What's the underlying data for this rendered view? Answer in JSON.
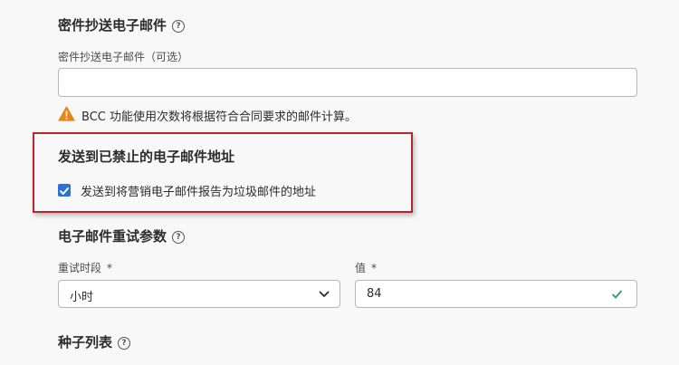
{
  "bcc_section": {
    "title": "密件抄送电子邮件",
    "field_label": "密件抄送电子邮件（可选）",
    "field_value": "",
    "warning_text": "BCC 功能使用次数将根据符合合同要求的邮件计算。"
  },
  "banned_section": {
    "title": "发送到已禁止的电子邮件地址",
    "checkbox_label": "发送到将营销电子邮件报告为垃圾邮件的地址",
    "checkbox_checked": true
  },
  "retry_section": {
    "title": "电子邮件重试参数",
    "period_label": "重试时段",
    "period_value": "小时",
    "value_label": "值",
    "value_value": "84",
    "required_mark": "*"
  },
  "seed_section": {
    "title": "种子列表"
  },
  "colors": {
    "highlight_border": "#b3282d",
    "checkbox": "#2f6fd8",
    "valid_check": "#2d9d78",
    "warning": "#e68619"
  },
  "icons": [
    "info-icon",
    "warning-icon",
    "checkmark-icon",
    "chevron-down-icon"
  ]
}
